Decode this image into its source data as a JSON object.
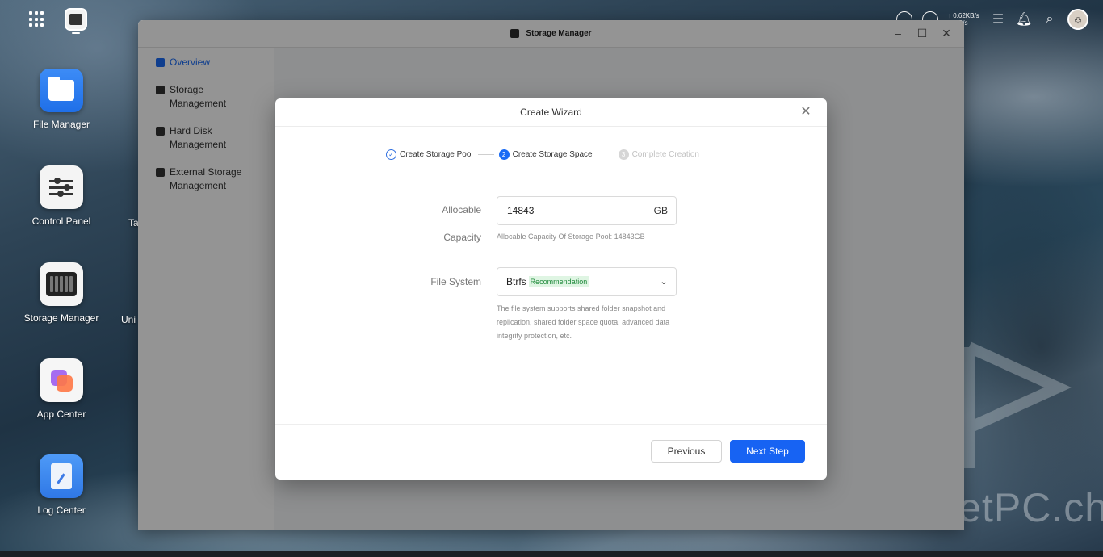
{
  "topbar": {
    "net_speed_up": "↑ 0.62KB/s",
    "net_speed_down": "↓ 0 B/s",
    "bell_icon": "bell-icon",
    "search_icon": "search-icon",
    "avatar_icon": "user-avatar"
  },
  "desktop": {
    "icons": [
      {
        "label": "File Manager",
        "icon": "folder-icon"
      },
      {
        "label": "Control Panel",
        "icon": "sliders-icon"
      },
      {
        "label": "Storage Manager",
        "icon": "storage-icon"
      },
      {
        "label": "App Center",
        "icon": "app-center-icon"
      },
      {
        "label": "Log Center",
        "icon": "log-icon"
      }
    ],
    "peek_labels": [
      "Ta",
      "Uni"
    ]
  },
  "window": {
    "title": "Storage Manager",
    "sidebar": [
      {
        "label": "Overview",
        "icon": "overview-icon",
        "active": true
      },
      {
        "label": "Storage Management",
        "icon": "storage-stack-icon"
      },
      {
        "label": "Hard Disk Management",
        "icon": "hard-disk-icon"
      },
      {
        "label": "External Storage Management",
        "icon": "external-storage-icon"
      }
    ]
  },
  "dialog": {
    "title": "Create Wizard",
    "steps": [
      {
        "label": "Create Storage Pool",
        "state": "done"
      },
      {
        "label": "Create Storage Space",
        "state": "current",
        "number": "2"
      },
      {
        "label": "Complete Creation",
        "state": "todo",
        "number": "3"
      }
    ],
    "capacity_label_1": "Allocable",
    "capacity_label_2": "Capacity",
    "capacity_value": "14843",
    "capacity_unit": "GB",
    "capacity_hint": "Allocable Capacity Of Storage Pool: 14843GB",
    "fs_label": "File System",
    "fs_value": "Btrfs",
    "fs_badge": "Recommendation",
    "fs_hint": "The file system supports shared folder snapshot and replication, shared folder space quota, advanced data integrity protection, etc.",
    "previous_label": "Previous",
    "next_label": "Next Step"
  },
  "watermark": "PocketPC.ch",
  "colors": {
    "accent": "#1763f3",
    "badge_bg": "#dff5e3",
    "badge_text": "#1f8a3b"
  }
}
